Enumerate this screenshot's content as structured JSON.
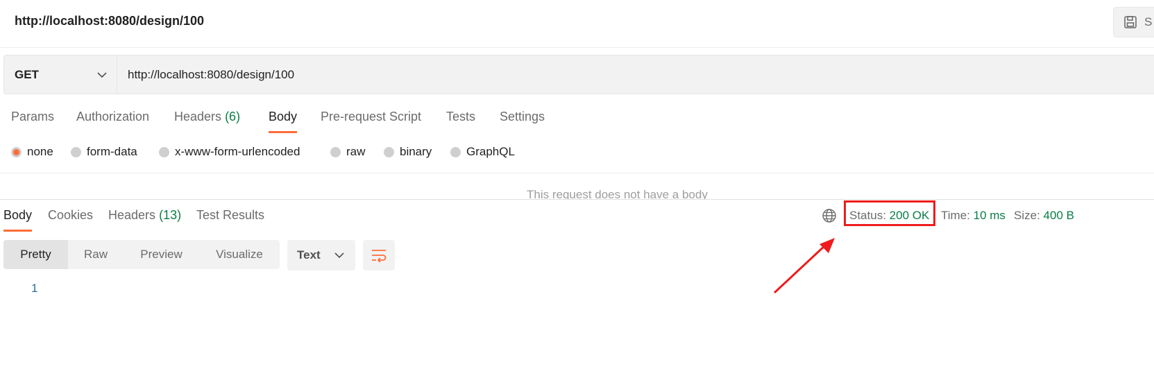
{
  "request": {
    "title": "http://localhost:8080/design/100",
    "save_label": "S",
    "method": "GET",
    "url": "http://localhost:8080/design/100"
  },
  "request_tabs": {
    "params": "Params",
    "authorization": "Authorization",
    "headers": "Headers",
    "headers_count": "(6)",
    "body": "Body",
    "prerequest": "Pre-request Script",
    "tests": "Tests",
    "settings": "Settings"
  },
  "body_types": {
    "none": "none",
    "form_data": "form-data",
    "urlencoded": "x-www-form-urlencoded",
    "raw": "raw",
    "binary": "binary",
    "graphql": "GraphQL",
    "selected": "none"
  },
  "empty_body_message": "This request does not have a body",
  "response_tabs": {
    "body": "Body",
    "cookies": "Cookies",
    "headers": "Headers",
    "headers_count": "(13)",
    "test_results": "Test Results"
  },
  "response_meta": {
    "status_label": "Status:",
    "status_value": "200 OK",
    "time_label": "Time:",
    "time_value": "10 ms",
    "size_label": "Size:",
    "size_value": "400 B"
  },
  "view_modes": {
    "pretty": "Pretty",
    "raw": "Raw",
    "preview": "Preview",
    "visualize": "Visualize",
    "selected": "Pretty"
  },
  "format": "Text",
  "editor": {
    "line_number": "1"
  },
  "colors": {
    "accent": "#ff6c37",
    "success": "#0a7d45",
    "annotation": "#ee1c1c"
  },
  "icons": [
    "save-icon",
    "chevron-down-icon",
    "globe-icon",
    "wrap-lines-icon"
  ]
}
